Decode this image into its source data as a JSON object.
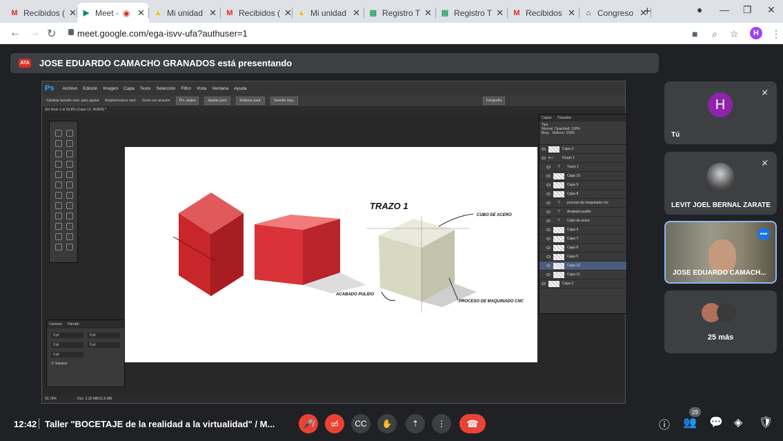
{
  "browser": {
    "tabs": [
      {
        "label": "Recibidos (",
        "icon": "gmail-icon",
        "color": "#d93025"
      },
      {
        "label": "Meet -",
        "icon": "meet-icon",
        "color": "#00897b",
        "active": true
      },
      {
        "label": "Mi unidad",
        "icon": "drive-icon",
        "color": "#fbbc04"
      },
      {
        "label": "Recibidos (",
        "icon": "gmail-icon",
        "color": "#d93025"
      },
      {
        "label": "Mi unidad",
        "icon": "drive-icon",
        "color": "#fbbc04"
      },
      {
        "label": "Registro T",
        "icon": "sheets-icon",
        "color": "#0f9d58"
      },
      {
        "label": "Registro T",
        "icon": "sheets-icon",
        "color": "#0f9d58"
      },
      {
        "label": "Recibidos",
        "icon": "gmail-icon",
        "color": "#d93025"
      },
      {
        "label": "Congreso",
        "icon": "congreso-icon",
        "color": "#333333"
      }
    ],
    "url": "meet.google.com/ega-isvv-ufa?authuser=1",
    "profile_initial": "H"
  },
  "meet": {
    "presenting_banner": "JOSE EDUARDO CAMACHO GRANADOS está presentando",
    "participants": [
      {
        "name": "Tú",
        "initial": "H",
        "muted": true
      },
      {
        "name": "LEVIT JOEL BERNAL ZARATE",
        "muted": true
      },
      {
        "name": "JOSE EDUARDO CAMACH...",
        "active_speaker": true
      }
    ],
    "more_count": "25 más",
    "participant_count": "29",
    "time": "12:42",
    "meeting_title": "Taller \"BOCETAJE de la realidad a la virtualidad\" / M..."
  },
  "photoshop": {
    "menu": [
      "Archivo",
      "Edición",
      "Imagen",
      "Capa",
      "Texto",
      "Selección",
      "Filtro",
      "Vista",
      "Ventana",
      "Ayuda"
    ],
    "options": [
      "Cambiar tamaño vent. para ajustar",
      "Ampliar/reducir vent.",
      "Zoom con arrastre",
      "Píx. reales",
      "Ajustar pant.",
      "Rellenar pant.",
      "Tamaño impr."
    ],
    "workspace": "Fotografía",
    "doc_tab": "Sin título-1 al 93,8% (Capa 12, RGB/8) *",
    "layers_tabs": [
      "Capas",
      "Trazados"
    ],
    "layers_filter": "Tipo",
    "blend_mode": "Normal",
    "opacity_label": "Opacidad:",
    "opacity": "100%",
    "lock_label": "Bloq.:",
    "fill_label": "Relleno:",
    "fill": "100%",
    "layers": [
      {
        "name": "Capa 3",
        "type": "pixel"
      },
      {
        "name": "Grupo 1",
        "type": "group"
      },
      {
        "name": "Trazo 1",
        "type": "text"
      },
      {
        "name": "Capa 10",
        "type": "pixel"
      },
      {
        "name": "Capa 9",
        "type": "pixel"
      },
      {
        "name": "Capa 8",
        "type": "pixel"
      },
      {
        "name": "proceso de maquinado cnc",
        "type": "text"
      },
      {
        "name": "Acabado pulido",
        "type": "text"
      },
      {
        "name": "Cubo de acero",
        "type": "text"
      },
      {
        "name": "Capa 4",
        "type": "pixel"
      },
      {
        "name": "Capa 7",
        "type": "pixel"
      },
      {
        "name": "Capa 6",
        "type": "pixel"
      },
      {
        "name": "Capa 5",
        "type": "pixel"
      },
      {
        "name": "Capa 12",
        "type": "pixel",
        "selected": true
      },
      {
        "name": "Capa 11",
        "type": "pixel"
      },
      {
        "name": "Capa 2",
        "type": "pixel"
      }
    ],
    "char_tabs": [
      "Carácter",
      "Párrafo"
    ],
    "char_values": [
      "0 pt",
      "0 pt",
      "0 pt",
      "0 pt",
      "0 pt"
    ],
    "hyphenate": "Separar",
    "zoom": "93,79%",
    "doc_info": "Doc: 2,36 MB/12,9 MB",
    "canvas_labels": {
      "title": "TRAZO 1",
      "steel_cube": "CUBO DE ACERO",
      "polished": "ACABADO PULIDO",
      "cnc": "PROCESO DE MAQUINADO CNC"
    }
  }
}
